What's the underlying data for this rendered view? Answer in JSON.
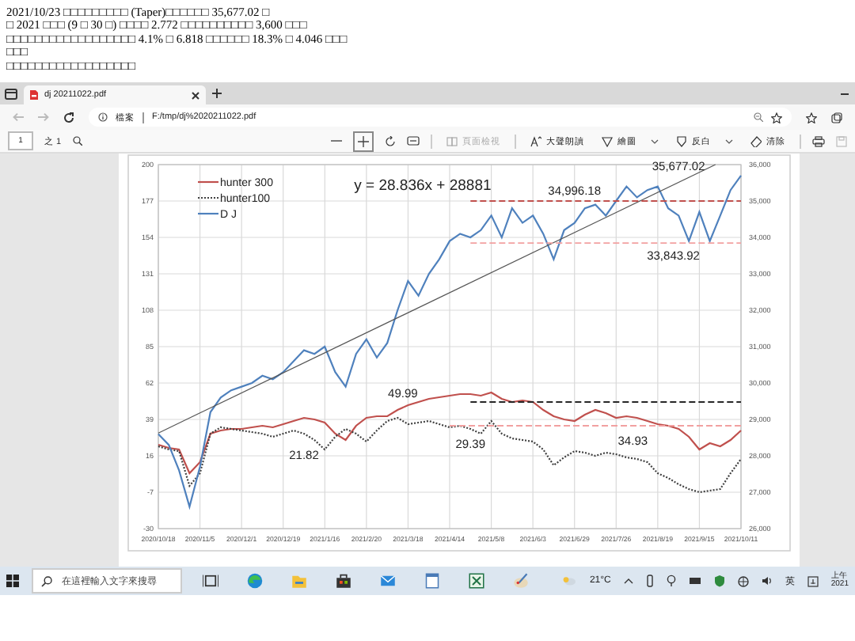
{
  "note_lines": [
    "2021/10/23 □□□□□□□□□ (Taper)□□□□□□ 35,677.02 □",
    "□ 2021 □□□ (9 □ 30 □) □□□□ 2.772 □□□□□□□□□□ 3,600 □□□",
    "□□□□□□□□□□□□□□□□□□ 4.1% □ 6.818 □□□□□□ 18.3% □ 4.046 □□□",
    "□□□",
    "□□□□□□□□□□□□□□□□□□"
  ],
  "browser": {
    "tabs": [
      {
        "title": "dj 20211022.pdf",
        "selected": true
      }
    ],
    "address": {
      "label": "檔案",
      "url": "F:/tmp/dj%2020211022.pdf"
    },
    "pdf_toolbar": {
      "page": "1",
      "page_count": "之 1",
      "items": [
        {
          "kind": "view",
          "label": "頁面檢視",
          "disabled": true,
          "menu": false
        },
        {
          "kind": "read",
          "label": "大聲朗讀",
          "disabled": false,
          "menu": false
        },
        {
          "kind": "draw",
          "label": "繪圖",
          "disabled": false,
          "menu": true
        },
        {
          "kind": "highlight",
          "label": "反白",
          "disabled": false,
          "menu": true
        },
        {
          "kind": "erase",
          "label": "清除",
          "disabled": false,
          "menu": false
        }
      ]
    },
    "chart": {
      "chart_data": {
        "type": "line",
        "categories": [
          "2020/10/18",
          null,
          null,
          null,
          "2020/11/5",
          null,
          null,
          null,
          "2020/12/1",
          null,
          null,
          null,
          "2020/12/19",
          null,
          null,
          null,
          "2021/1/16",
          null,
          null,
          null,
          "2021/2/20",
          null,
          null,
          null,
          "2021/3/18",
          null,
          null,
          null,
          "2021/4/14",
          null,
          null,
          null,
          "2021/5/8",
          null,
          null,
          null,
          "2021/6/3",
          null,
          null,
          null,
          "2021/6/29",
          null,
          null,
          null,
          "2021/7/26",
          null,
          null,
          null,
          "2021/8/19",
          null,
          null,
          null,
          "2021/9/15",
          null,
          null,
          null,
          "2021/10/11"
        ],
        "ylim": [
          -30,
          200
        ],
        "y2lim": [
          26000,
          36000
        ],
        "yticks": [
          -30,
          -7,
          16,
          39,
          62,
          85,
          108,
          131,
          154,
          177,
          200
        ],
        "y2ticks": [
          {
            "value": 26000,
            "label": "26,000"
          },
          {
            "value": 27000,
            "label": "27,000"
          },
          {
            "value": 28000,
            "label": "28,000"
          },
          {
            "value": 29000,
            "label": "29,000"
          },
          {
            "value": 30000,
            "label": "30,000"
          },
          {
            "value": 31000,
            "label": "31,000"
          },
          {
            "value": 32000,
            "label": "32,000"
          },
          {
            "value": 33000,
            "label": "33,000"
          },
          {
            "value": 34000,
            "label": "34,000"
          },
          {
            "value": 35000,
            "label": "35,000"
          },
          {
            "value": 36000,
            "label": "36,000"
          }
        ],
        "series": [
          {
            "name": "hunter 300",
            "color": "#c0504d",
            "line_style": "solid",
            "values": [
              23,
              21,
              20,
              5,
              12,
              30,
              32,
              33,
              33,
              34,
              35,
              34,
              36,
              38,
              40,
              39,
              37,
              30,
              26,
              35,
              40,
              41,
              41,
              45,
              48,
              50,
              52,
              53,
              54,
              55,
              55,
              54,
              56,
              52,
              50,
              51,
              50,
              45,
              41,
              39,
              38,
              42,
              45,
              43,
              40,
              41,
              40,
              38,
              36,
              35,
              33,
              28,
              20,
              24,
              22,
              26,
              32
            ]
          },
          {
            "name": "hunter100",
            "color": "#404040",
            "line_style": "dotted",
            "values": [
              22,
              20,
              19,
              -3,
              5,
              30,
              34,
              33,
              32,
              31,
              30,
              28,
              30,
              32,
              30,
              26,
              20,
              28,
              33,
              30,
              25,
              32,
              38,
              40,
              36,
              37,
              38,
              36,
              34,
              35,
              33,
              30,
              38,
              30,
              27,
              26,
              25,
              20,
              10,
              15,
              19,
              18,
              16,
              18,
              17,
              15,
              14,
              12,
              5,
              2,
              -2,
              -5,
              -7,
              -6,
              -5,
              5,
              14
            ]
          },
          {
            "name": "D J",
            "color": "#4f81bd",
            "axis": "y2",
            "line_style": "solid",
            "values": [
              28600,
              28300,
              27600,
              26600,
              27700,
              29200,
              29600,
              29800,
              29900,
              30000,
              30200,
              30100,
              30300,
              30600,
              30900,
              30800,
              31000,
              30300,
              29900,
              30800,
              31200,
              30700,
              31100,
              32000,
              32800,
              32400,
              33000,
              33400,
              33900,
              34100,
              34000,
              34200,
              34600,
              34000,
              34800,
              34400,
              34600,
              34100,
              33400,
              34200,
              34400,
              34800,
              34900,
              34600,
              35000,
              35400,
              35100,
              35300,
              35400,
              34800,
              34600,
              33900,
              34700,
              33900,
              34600,
              35300,
              35700
            ]
          }
        ],
        "ref_lines": [
          {
            "value": 35000,
            "axis": "y2",
            "color": "#c0504d"
          },
          {
            "value": 33844,
            "axis": "y2",
            "color": "#f2a0a0"
          },
          {
            "value": 49.99,
            "axis": "y",
            "color": "#262626"
          },
          {
            "value": 35,
            "axis": "y",
            "color": "#f2a0a0"
          }
        ],
        "grid": true,
        "legend": "upper left",
        "annotations": [
          "y = 28.836x + 28881",
          "34,996.18",
          "35,677.02",
          "33,843.92",
          "49.99",
          "21.82",
          "29.39",
          "34.93"
        ]
      }
    }
  },
  "taskbar": {
    "search": {
      "placeholder": "在這裡輸入文字來搜尋"
    },
    "weather": "21°C",
    "language": "英",
    "clock": [
      "上午",
      "2021"
    ]
  }
}
